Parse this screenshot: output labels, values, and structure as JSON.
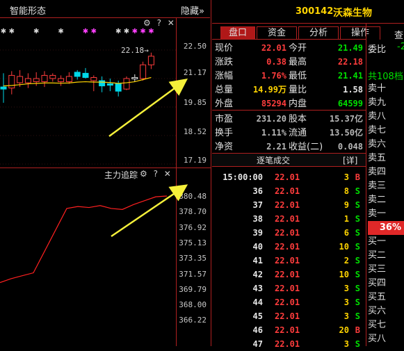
{
  "header": {
    "stock_code": "300142",
    "stock_name": "沃森生物"
  },
  "left_top": {
    "title": "智能形态",
    "hide_label": "隐藏»",
    "gear": "⚙",
    "help": "?",
    "close": "✕",
    "price_labels": [
      "22.50",
      "21.17",
      "19.85",
      "18.52",
      "17.19"
    ],
    "annotation": "22.18→",
    "candles": [
      {
        "o": 20.55,
        "h": 21.2,
        "l": 19.8,
        "c": 20.45,
        "color": "cyan"
      },
      {
        "o": 20.5,
        "h": 21.3,
        "l": 20.2,
        "c": 21.1,
        "color": "red"
      },
      {
        "o": 21.05,
        "h": 21.35,
        "l": 20.55,
        "c": 20.75,
        "color": "red"
      },
      {
        "o": 20.75,
        "h": 21.2,
        "l": 20.5,
        "c": 20.95,
        "color": "red"
      },
      {
        "o": 20.95,
        "h": 21.25,
        "l": 20.6,
        "c": 20.8,
        "color": "red"
      },
      {
        "o": 20.8,
        "h": 21.3,
        "l": 20.55,
        "c": 21.1,
        "color": "red"
      },
      {
        "o": 21.1,
        "h": 21.2,
        "l": 20.8,
        "c": 20.95,
        "color": "red"
      },
      {
        "o": 20.95,
        "h": 21.1,
        "l": 20.6,
        "c": 20.8,
        "color": "red"
      },
      {
        "o": 20.8,
        "h": 21.25,
        "l": 20.7,
        "c": 21.05,
        "color": "red"
      },
      {
        "o": 21.05,
        "h": 21.35,
        "l": 20.9,
        "c": 21.25,
        "color": "cyan"
      },
      {
        "o": 21.2,
        "h": 21.45,
        "l": 20.95,
        "c": 21.0,
        "color": "cyan"
      },
      {
        "o": 21.0,
        "h": 21.1,
        "l": 20.35,
        "c": 20.85,
        "color": "red"
      },
      {
        "o": 20.85,
        "h": 21.05,
        "l": 20.3,
        "c": 20.6,
        "color": "cyan"
      },
      {
        "o": 20.65,
        "h": 20.95,
        "l": 20.35,
        "c": 20.7,
        "color": "cyan"
      },
      {
        "o": 20.7,
        "h": 20.85,
        "l": 20.1,
        "c": 20.35,
        "color": "cyan"
      },
      {
        "o": 20.45,
        "h": 21.05,
        "l": 20.4,
        "c": 20.95,
        "color": "red"
      },
      {
        "o": 21.0,
        "h": 21.15,
        "l": 20.8,
        "c": 21.0,
        "color": "white"
      },
      {
        "o": 20.95,
        "h": 21.75,
        "l": 20.85,
        "c": 21.6,
        "color": "red"
      },
      {
        "o": 21.6,
        "h": 22.18,
        "l": 21.4,
        "c": 22.01,
        "color": "red"
      }
    ],
    "ma": [
      20.6,
      20.62,
      20.66,
      20.7,
      20.72,
      20.74,
      20.74,
      20.73,
      20.74,
      20.78,
      20.8,
      20.78,
      20.78,
      20.76,
      20.72,
      20.75,
      20.8,
      20.9,
      21.0
    ],
    "star_marks": [
      {
        "i": 0,
        "color": "#d8d8d8"
      },
      {
        "i": 1,
        "color": "#d8d8d8"
      },
      {
        "i": 4,
        "color": "#d8d8d8"
      },
      {
        "i": 7,
        "color": "#d8d8d8"
      },
      {
        "i": 10,
        "color": "#ff40ff"
      },
      {
        "i": 11,
        "color": "#ff40ff"
      },
      {
        "i": 14,
        "color": "#d8d8d8"
      },
      {
        "i": 15,
        "color": "#d8d8d8"
      },
      {
        "i": 16,
        "color": "#ff40ff"
      },
      {
        "i": 17,
        "color": "#ff40ff"
      },
      {
        "i": 18,
        "color": "#ff40ff"
      }
    ]
  },
  "left_bottom": {
    "title": "主力追踪",
    "gear": "⚙",
    "help": "?",
    "close": "✕",
    "axis_labels": [
      "380.48",
      "378.70",
      "376.92",
      "375.13",
      "373.35",
      "371.57",
      "369.79",
      "368.00",
      "366.22"
    ],
    "line_values": [
      371.6,
      372.0,
      372.3,
      372.6,
      374.8,
      377.0,
      379.2,
      379.4,
      379.3,
      379.5,
      379.2,
      379.1,
      379.6,
      380.0,
      380.4,
      380.48
    ]
  },
  "tabs": [
    {
      "label": "盘口",
      "active": true
    },
    {
      "label": "资金",
      "active": false
    },
    {
      "label": "分析",
      "active": false
    },
    {
      "label": "操作",
      "active": false
    }
  ],
  "quotes": [
    {
      "l1": "现价",
      "v1": "22.01",
      "c1": "red",
      "l2": "今开",
      "v2": "21.49",
      "c2": "green"
    },
    {
      "l1": "涨跌",
      "v1": "0.38",
      "c1": "red",
      "l2": "最高",
      "v2": "22.18",
      "c2": "red"
    },
    {
      "l1": "涨幅",
      "v1": "1.76%",
      "c1": "red",
      "l2": "最低",
      "v2": "21.41",
      "c2": "green"
    },
    {
      "l1": "总量",
      "v1": "14.99万",
      "c1": "yellow",
      "l2": "量比",
      "v2": "1.58",
      "c2": "white"
    },
    {
      "l1": "外盘",
      "v1": "85294",
      "c1": "red",
      "l2": "内盘",
      "v2": "64599",
      "c2": "green"
    },
    {
      "l1": "市盈",
      "v1": "231.20",
      "c1": "gray",
      "l2": "股本",
      "v2": "15.37亿",
      "c2": "gray"
    },
    {
      "l1": "换手",
      "v1": "1.11%",
      "c1": "gray",
      "l2": "流通",
      "v2": "13.50亿",
      "c2": "gray"
    },
    {
      "l1": "净资",
      "v1": "2.21",
      "c1": "gray",
      "l2": "收益(二)",
      "v2": "0.048",
      "c2": "gray"
    }
  ],
  "trades_header": {
    "title": "逐笔成交",
    "detail": "[详]"
  },
  "trades": [
    {
      "time": "15:00:00",
      "price": "22.01",
      "vol": "3",
      "side": "B"
    },
    {
      "time": "36",
      "price": "22.01",
      "vol": "8",
      "side": "S"
    },
    {
      "time": "37",
      "price": "22.01",
      "vol": "9",
      "side": "S"
    },
    {
      "time": "38",
      "price": "22.01",
      "vol": "1",
      "side": "S"
    },
    {
      "time": "39",
      "price": "22.01",
      "vol": "6",
      "side": "S"
    },
    {
      "time": "40",
      "price": "22.01",
      "vol": "10",
      "side": "S"
    },
    {
      "time": "41",
      "price": "22.01",
      "vol": "2",
      "side": "S"
    },
    {
      "time": "42",
      "price": "22.01",
      "vol": "10",
      "side": "S"
    },
    {
      "time": "43",
      "price": "22.01",
      "vol": "3",
      "side": "S"
    },
    {
      "time": "44",
      "price": "22.01",
      "vol": "3",
      "side": "S"
    },
    {
      "time": "45",
      "price": "22.01",
      "vol": "3",
      "side": "S"
    },
    {
      "time": "46",
      "price": "22.01",
      "vol": "20",
      "side": "B"
    },
    {
      "time": "47",
      "price": "22.01",
      "vol": "3",
      "side": "S"
    }
  ],
  "order_book": {
    "ratio_label": "委比",
    "ratio_value": "-2",
    "total_label": "共108档",
    "col_head": "查",
    "sells": [
      "卖十",
      "卖九",
      "卖八",
      "卖七",
      "卖六",
      "卖五",
      "卖四",
      "卖三",
      "卖二",
      "卖一"
    ],
    "badge": "36%",
    "buys": [
      "买一",
      "买二",
      "买三",
      "买四",
      "买五",
      "买六",
      "买七",
      "买八"
    ]
  },
  "colors": {
    "up": "#ff3c3c",
    "down": "#00e000",
    "border": "#b02020",
    "cyan": "#00d8e8",
    "annotation_arrow": "#f5f03a"
  }
}
